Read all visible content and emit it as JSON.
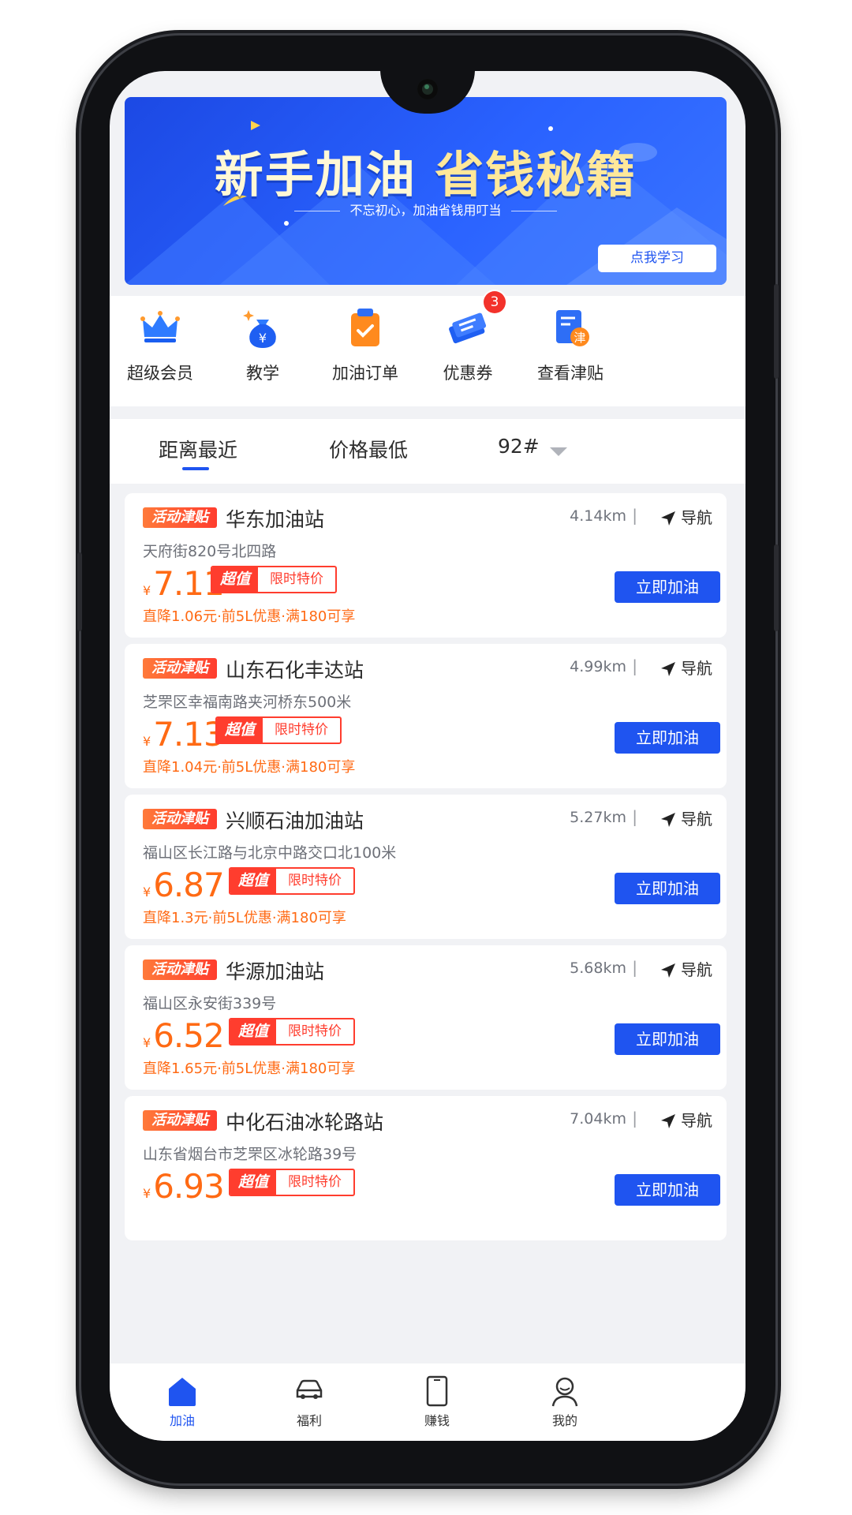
{
  "banner": {
    "title_part1": "新手加油 ",
    "title_part2": "省钱秘籍",
    "subtitle": "不忘初心，加油省钱用叮当",
    "button": "点我学习"
  },
  "menu": [
    {
      "label": "超级会员",
      "icon": "crown-icon"
    },
    {
      "label": "教学",
      "icon": "money-bag-icon"
    },
    {
      "label": "加油订单",
      "icon": "order-clipboard-icon"
    },
    {
      "label": "优惠券",
      "icon": "coupon-icon",
      "badge": "3"
    },
    {
      "label": "查看津贴",
      "icon": "allowance-doc-icon"
    }
  ],
  "sort": {
    "nearest": "距离最近",
    "cheapest": "价格最低",
    "fuel": "92#"
  },
  "stations": [
    {
      "tag": "活动津贴",
      "name": "华东加油站",
      "distance": "4.14km",
      "nav": "导航",
      "address": "天府街820号北四路",
      "yen": "¥",
      "price": "7.11",
      "special_a": "超值",
      "special_b": "限时特价",
      "promo": "直降1.06元·前5L优惠·满180可享",
      "button": "立即加油"
    },
    {
      "tag": "活动津贴",
      "name": "山东石化丰达站",
      "distance": "4.99km",
      "nav": "导航",
      "address": "芝罘区幸福南路夹河桥东500米",
      "yen": "¥",
      "price": "7.13",
      "special_a": "超值",
      "special_b": "限时特价",
      "promo": "直降1.04元·前5L优惠·满180可享",
      "button": "立即加油"
    },
    {
      "tag": "活动津贴",
      "name": "兴顺石油加油站",
      "distance": "5.27km",
      "nav": "导航",
      "address": "福山区长江路与北京中路交口北100米",
      "yen": "¥",
      "price": "6.87",
      "special_a": "超值",
      "special_b": "限时特价",
      "promo": "直降1.3元·前5L优惠·满180可享",
      "button": "立即加油"
    },
    {
      "tag": "活动津贴",
      "name": "华源加油站",
      "distance": "5.68km",
      "nav": "导航",
      "address": "福山区永安街339号",
      "yen": "¥",
      "price": "6.52",
      "special_a": "超值",
      "special_b": "限时特价",
      "promo": "直降1.65元·前5L优惠·满180可享",
      "button": "立即加油"
    },
    {
      "tag": "活动津贴",
      "name": "中化石油冰轮路站",
      "distance": "7.04km",
      "nav": "导航",
      "address": "山东省烟台市芝罘区冰轮路39号",
      "yen": "¥",
      "price": "6.93",
      "special_a": "超值",
      "special_b": "限时特价",
      "promo": "",
      "button": "立即加油"
    }
  ],
  "tabs": [
    {
      "label": "加油",
      "icon": "gas-station-home-icon"
    },
    {
      "label": "福利",
      "icon": "car-icon"
    },
    {
      "label": "赚钱",
      "icon": "phone-icon"
    },
    {
      "label": "我的",
      "icon": "user-icon"
    }
  ],
  "colors": {
    "primary": "#1f54f0",
    "price": "#ff6a14",
    "tag": "#ff3d2e"
  }
}
